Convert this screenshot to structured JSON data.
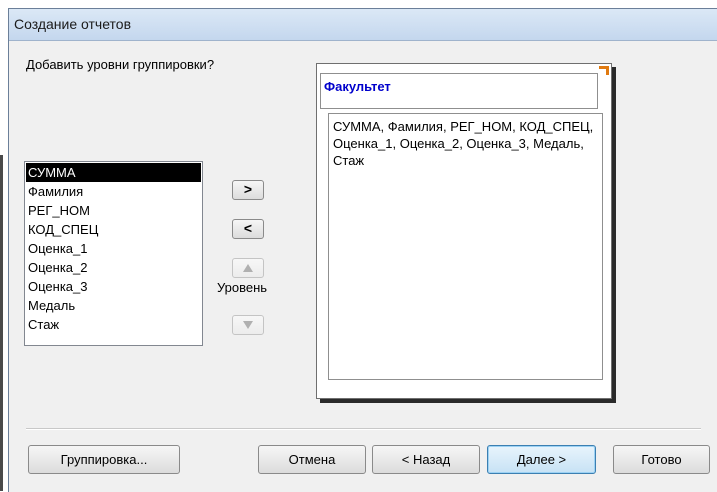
{
  "window": {
    "title": "Создание отчетов"
  },
  "prompt": "Добавить уровни группировки?",
  "fields": [
    "СУММА",
    "Фамилия",
    "РЕГ_НОМ",
    "КОД_СПЕЦ",
    "Оценка_1",
    "Оценка_2",
    "Оценка_3",
    "Медаль",
    "Стаж"
  ],
  "selected_field": "СУММА",
  "controls": {
    "add": ">",
    "remove": "<",
    "up_icon": "arrow-up-icon",
    "down_icon": "arrow-down-icon",
    "level_label": "Уровень"
  },
  "preview": {
    "group_header": "Факультет",
    "group_fields": "СУММА, Фамилия, РЕГ_НОМ, КОД_СПЕЦ, Оценка_1, Оценка_2, Оценка_3, Медаль, Стаж"
  },
  "buttons": {
    "grouping": "Группировка...",
    "cancel": "Отмена",
    "back": "< Назад",
    "next": "Далее >",
    "finish": "Готово"
  },
  "colors": {
    "accent": "#0000cc",
    "selection": "#000000"
  }
}
